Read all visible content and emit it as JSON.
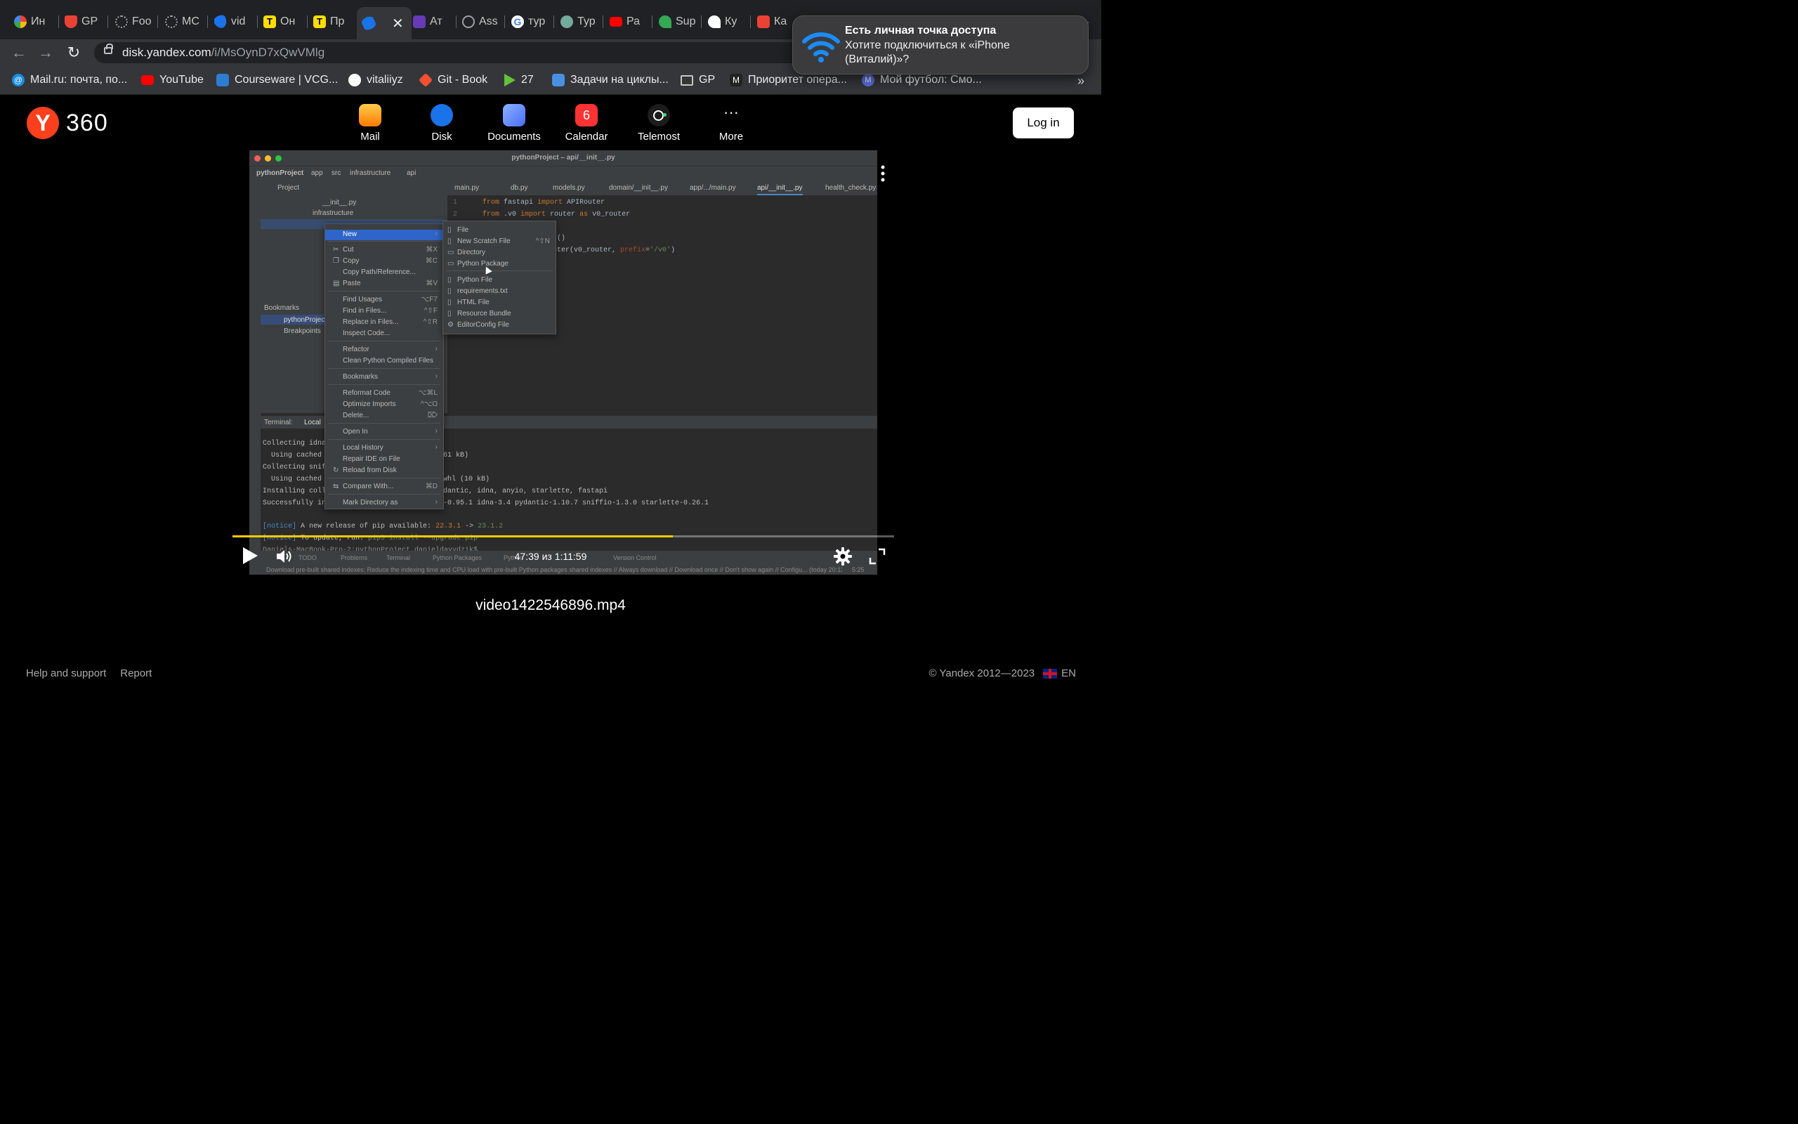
{
  "browser": {
    "tabs": [
      {
        "label": "Ин",
        "color": "#4285f4"
      },
      {
        "label": "GP",
        "color": "#e94235"
      },
      {
        "label": "Foo",
        "color": "#5f6368"
      },
      {
        "label": "MC",
        "color": "#5f6368"
      },
      {
        "label": "vid",
        "color": "#1a73e8"
      },
      {
        "label": "Он",
        "color": "#ffdd00"
      },
      {
        "label": "Пр",
        "color": "#ffdd00"
      },
      {
        "label": "",
        "color": "#1a73e8"
      },
      {
        "label": "Ат",
        "color": "#673ab7"
      },
      {
        "label": "Ass",
        "color": "#9aa0a6"
      },
      {
        "label": "тур",
        "color": "#ffffff"
      },
      {
        "label": "Тур",
        "color": "#74aa9c"
      },
      {
        "label": "Ра",
        "color": "#ff0000"
      },
      {
        "label": "Sup",
        "color": "#34a853"
      },
      {
        "label": "Ку",
        "color": "#ffffff"
      },
      {
        "label": "Ка",
        "color": "#ea4335"
      }
    ],
    "address": {
      "host": "disk.yandex.com",
      "path": "/i/MsOynD7xQwVMlg"
    },
    "bookmarks": [
      {
        "label": "Mail.ru: почта, по...",
        "color": "#168de2"
      },
      {
        "label": "YouTube",
        "color": "#ff0000"
      },
      {
        "label": "Courseware | VCG...",
        "color": "#2d7dd2"
      },
      {
        "label": "vitaliiyz",
        "color": "#ffffff"
      },
      {
        "label": "Git - Book",
        "color": "#f05133"
      },
      {
        "label": "27",
        "color": "#64c13a"
      },
      {
        "label": "Задачи на циклы...",
        "color": "#4a90e2"
      },
      {
        "label": "GP",
        "color": "#9aa0a6"
      },
      {
        "label": "Приоритет опера...",
        "color": "#222222"
      },
      {
        "label": "Мой футбол: Смо...",
        "color": "#5a6fe0"
      }
    ],
    "more_bookmarks": "»"
  },
  "notification": {
    "title": "Есть личная точка доступа",
    "body": "Хотите подключиться к «iPhone (Виталий)»?",
    "icon": "wifi-icon"
  },
  "header": {
    "logo_letter": "Y",
    "logo_text": "360",
    "services": [
      {
        "label": "Mail",
        "icon": "mail-icon"
      },
      {
        "label": "Disk",
        "icon": "disk-icon"
      },
      {
        "label": "Documents",
        "icon": "documents-icon"
      },
      {
        "label": "Calendar",
        "icon": "calendar-icon",
        "badge": "6"
      },
      {
        "label": "Telemost",
        "icon": "telemost-icon"
      },
      {
        "label": "More",
        "icon": "more-icon"
      }
    ],
    "login_label": "Log in"
  },
  "video": {
    "ide": {
      "window_title": "pythonProject – api/__init__.py",
      "breadcrumb": [
        "pythonProject",
        "app",
        "src",
        "infrastructure",
        "api"
      ],
      "project_label": "Project",
      "editor_tabs": [
        "main.py",
        "db.py",
        "models.py",
        "domain/__init__.py",
        "app/.../main.py",
        "api/__init__.py",
        "health_check.py"
      ],
      "tree": [
        "__init__.py",
        "infrastructure"
      ],
      "bookmarks_title": "Bookmarks",
      "bookmarks": [
        "pythonProject",
        "Breakpoints"
      ],
      "code_line_numbers": [
        "1",
        "2"
      ],
      "code": {
        "line1": [
          "from",
          " fastapi ",
          "import",
          " APIRouter"
        ],
        "line2": [
          "from",
          " .v0 ",
          "import",
          " router ",
          "as",
          " v0_router"
        ],
        "line3": "r()",
        "line4_a": "uter(v0_router, ",
        "line4_param": "prefix",
        "line4_b": "=",
        "line4_str": "'/v0'",
        "line4_c": ")"
      },
      "terminal_tabs": [
        "Terminal:",
        "Local"
      ],
      "terminal_lines": [
        "Collecting idna",
        "  Using cached",
        "Collecting snif",
        "  Using cached",
        "Installing coll",
        "Successfully in"
      ],
      "terminal_right": [
        "61 kB)",
        "whl (10 kB)",
        "dantic, idna, anyio, starlette, fastapi",
        "-0.95.1 idna-3.4 pydantic-1.10.7 sniffio-1.3.0 starlette-0.26.1"
      ],
      "notice1": {
        "tag": "[notice]",
        "text": " A new release of pip available: ",
        "old": "22.3.1",
        "arrow": " -> ",
        "new": "23.1.2"
      },
      "notice2": {
        "tag": "[notice]",
        "text": " To update, run: ",
        "cmd": "pip3 install --upgrade pip"
      },
      "prompt": "Daniels-MacBook-Pro-2:pythonProject danieldavydzik$",
      "status_tabs": [
        "TODO",
        "Problems",
        "Terminal",
        "Python Packages",
        "Python",
        "Version Control"
      ],
      "status_bar": "Download pre-built shared indexes: Reduce the indexing time and CPU load with pre-built Python packages shared indexes // Always download // Download once // Don't show again // Configu... (today 20:12",
      "status_pos": "5:25",
      "context_menu": [
        {
          "label": "New",
          "arrow": "›",
          "highlight": true
        },
        {
          "label": "Cut",
          "shortcut": "⌘X",
          "icon": "✂"
        },
        {
          "label": "Copy",
          "shortcut": "⌘C",
          "icon": "❐"
        },
        {
          "label": "Copy Path/Reference..."
        },
        {
          "label": "Paste",
          "shortcut": "⌘V",
          "icon": "▤"
        },
        {
          "label": "Find Usages",
          "shortcut": "⌥F7"
        },
        {
          "label": "Find in Files...",
          "shortcut": "^⇧F"
        },
        {
          "label": "Replace in Files...",
          "shortcut": "^⇧R"
        },
        {
          "label": "Inspect Code..."
        },
        {
          "label": "Refactor",
          "arrow": "›"
        },
        {
          "label": "Clean Python Compiled Files"
        },
        {
          "label": "Bookmarks",
          "arrow": "›"
        },
        {
          "label": "Reformat Code",
          "shortcut": "⌥⌘L"
        },
        {
          "label": "Optimize Imports",
          "shortcut": "^⌥O"
        },
        {
          "label": "Delete...",
          "shortcut": "⌦"
        },
        {
          "label": "Open In",
          "arrow": "›"
        },
        {
          "label": "Local History",
          "arrow": "›"
        },
        {
          "label": "Repair IDE on File"
        },
        {
          "label": "Reload from Disk",
          "icon": "↻"
        },
        {
          "label": "Compare With...",
          "shortcut": "⌘D",
          "icon": "⇆"
        },
        {
          "label": "Mark Directory as",
          "arrow": "›"
        }
      ],
      "submenu": [
        {
          "label": "File",
          "icon": "▯"
        },
        {
          "label": "New Scratch File",
          "shortcut": "^⇧N",
          "icon": "▯"
        },
        {
          "label": "Directory",
          "icon": "▭"
        },
        {
          "label": "Python Package",
          "icon": "▭"
        },
        {
          "label": "Python File",
          "icon": "▯"
        },
        {
          "label": "requirements.txt",
          "icon": "▯"
        },
        {
          "label": "HTML File",
          "icon": "▯"
        },
        {
          "label": "Resource Bundle",
          "icon": "▯"
        },
        {
          "label": "EditorConfig File",
          "icon": "⚙"
        }
      ]
    },
    "player": {
      "current_time": "47:39",
      "separator": "из",
      "duration": "1:11:59",
      "progress_fraction": 0.666,
      "accent": "#ffcc00"
    },
    "filename": "video1422546896.mp4"
  },
  "footer": {
    "links": [
      "Help and support",
      "Report"
    ],
    "copyright": "© Yandex 2012—2023",
    "language": "EN"
  }
}
